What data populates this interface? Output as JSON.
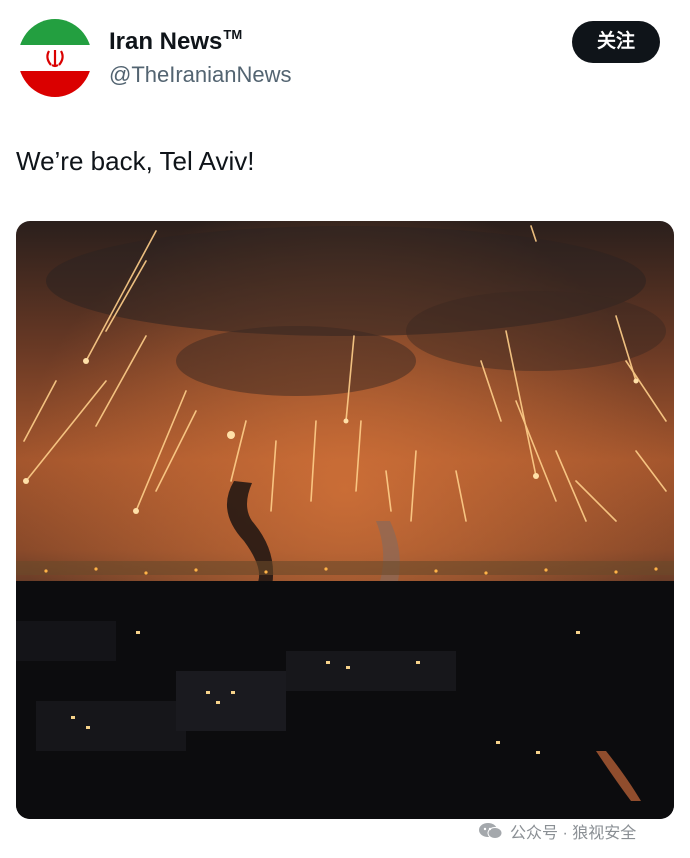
{
  "account": {
    "name": "Iran News",
    "trademark": "TM",
    "handle": "@TheIranianNews",
    "avatar_icon": "iran-flag-icon"
  },
  "follow_label": "关注",
  "tweet": {
    "text": "We’re back, Tel Aviv!"
  },
  "media": {
    "description_icon": "night-sky-explosions-photo"
  },
  "footer": {
    "brand_icon": "wechat-icon",
    "brand_text": "公众号 · 狼视安全"
  },
  "colors": {
    "flag_green": "#239f40",
    "flag_white": "#ffffff",
    "flag_red": "#da0000",
    "follow_bg": "#0f1419",
    "handle_gray": "#536471"
  }
}
